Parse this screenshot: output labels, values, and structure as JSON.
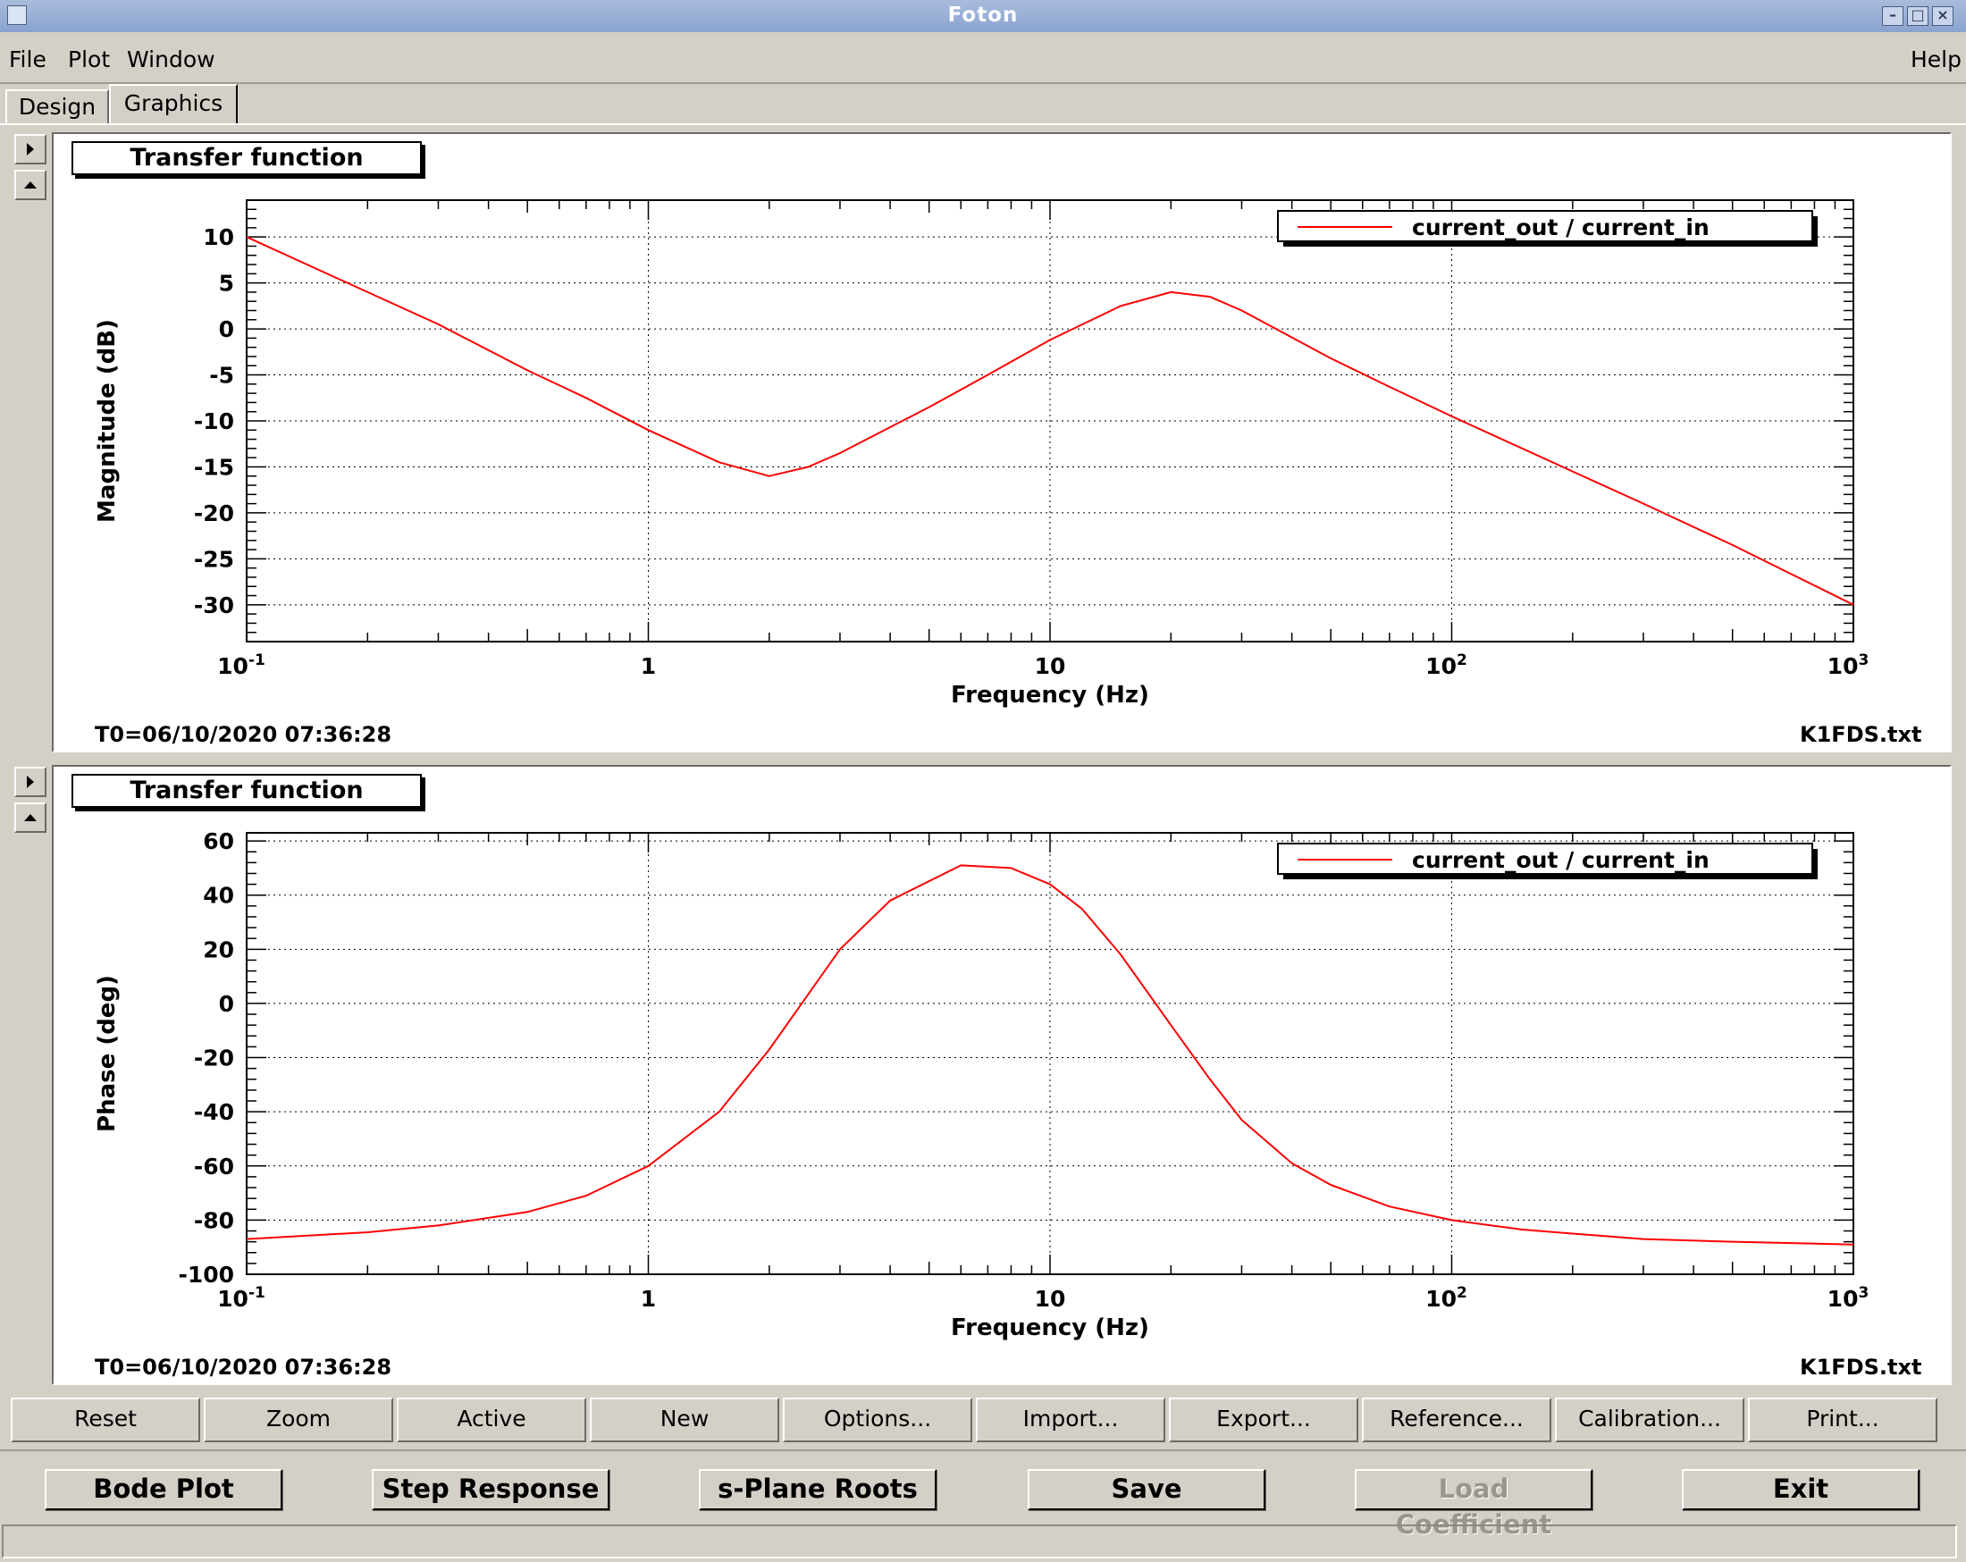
{
  "window": {
    "title": "Foton"
  },
  "menu": {
    "file": "File",
    "plot": "Plot",
    "window": "Window",
    "help": "Help"
  },
  "tabs": [
    {
      "label": "Design"
    },
    {
      "label": "Graphics"
    }
  ],
  "panels": [
    {
      "title": "Transfer function",
      "t0": "T0=06/10/2020 07:36:28",
      "file": "K1FDS.txt"
    },
    {
      "title": "Transfer function",
      "t0": "T0=06/10/2020 07:36:28",
      "file": "K1FDS.txt"
    }
  ],
  "chart_data": [
    {
      "type": "line",
      "xscale": "log",
      "xlim": [
        0.1,
        1000
      ],
      "ylim": [
        -34,
        14
      ],
      "xlabel": "Frequency (Hz)",
      "ylabel": "Magnitude (dB)",
      "xticks": [
        "10^-1",
        "1",
        "10",
        "10^2",
        "10^3"
      ],
      "yticks": [
        "10",
        "5",
        "0",
        "-5",
        "-10",
        "-15",
        "-20",
        "-25",
        "-30"
      ],
      "grid": true,
      "legend_position": "top-right",
      "series": [
        {
          "name": "current_out / current_in",
          "color": "#ff0000",
          "x": [
            0.1,
            0.2,
            0.3,
            0.5,
            0.7,
            1,
            1.5,
            2,
            2.5,
            3,
            5,
            7,
            10,
            15,
            20,
            25,
            30,
            50,
            70,
            100,
            200,
            300,
            500,
            1000
          ],
          "y": [
            10,
            4,
            0.5,
            -4.5,
            -7.5,
            -11,
            -14.5,
            -16,
            -15,
            -13.5,
            -8.5,
            -5,
            -1.2,
            2.5,
            4,
            3.5,
            2,
            -3.2,
            -6.3,
            -9.5,
            -15.5,
            -19,
            -23.5,
            -30
          ]
        }
      ]
    },
    {
      "type": "line",
      "xscale": "log",
      "xlim": [
        0.1,
        1000
      ],
      "ylim": [
        -100,
        63
      ],
      "xlabel": "Frequency (Hz)",
      "ylabel": "Phase (deg)",
      "xticks": [
        "10^-1",
        "1",
        "10",
        "10^2",
        "10^3"
      ],
      "yticks": [
        "60",
        "40",
        "20",
        "0",
        "-20",
        "-40",
        "-60",
        "-80",
        "-100"
      ],
      "grid": true,
      "legend_position": "top-right",
      "series": [
        {
          "name": "current_out / current_in",
          "color": "#ff0000",
          "x": [
            0.1,
            0.2,
            0.3,
            0.5,
            0.7,
            1,
            1.5,
            2,
            3,
            4,
            6,
            8,
            10,
            12,
            15,
            20,
            25,
            30,
            40,
            50,
            70,
            100,
            150,
            200,
            300,
            500,
            1000
          ],
          "y": [
            -87,
            -84.5,
            -82,
            -77,
            -71,
            -60,
            -40,
            -17,
            20,
            38,
            51,
            50,
            44,
            35,
            18,
            -8,
            -28,
            -43,
            -59,
            -67,
            -75,
            -80,
            -83.5,
            -85,
            -87,
            -88,
            -89
          ]
        }
      ]
    }
  ],
  "toolbar": {
    "reset": "Reset",
    "zoom": "Zoom",
    "active": "Active",
    "new": "New",
    "options": "Options...",
    "import": "Import...",
    "export": "Export...",
    "reference": "Reference...",
    "calibration": "Calibration...",
    "print": "Print..."
  },
  "bottom": {
    "bode": "Bode Plot",
    "step": "Step Response",
    "splane": "s-Plane Roots",
    "save": "Save",
    "load": "Load Coefficient",
    "exit": "Exit"
  }
}
